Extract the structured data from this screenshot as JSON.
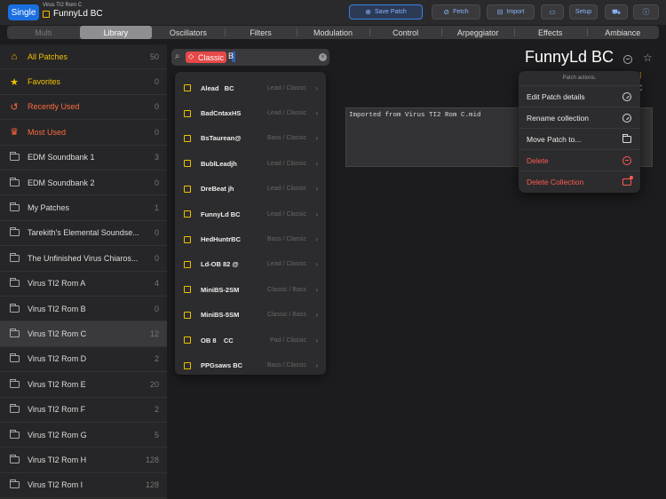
{
  "topbar": {
    "mode_label": "Single",
    "rom_name": "Virus TI2 Rom C",
    "patch_name": "FunnyLd BC",
    "buttons": {
      "save": "Save Patch",
      "fetch": "Fetch",
      "import": "Import",
      "setup": "Setup"
    }
  },
  "tabs": [
    {
      "label": "Multi",
      "state": "disabled"
    },
    {
      "label": "Library",
      "state": "active"
    },
    {
      "label": "Oscillators",
      "state": "normal"
    },
    {
      "label": "Filters",
      "state": "normal"
    },
    {
      "label": "Modulation",
      "state": "normal"
    },
    {
      "label": "Control",
      "state": "normal"
    },
    {
      "label": "Arpeggiator",
      "state": "normal"
    },
    {
      "label": "Effects",
      "state": "normal"
    },
    {
      "label": "Ambiance",
      "state": "normal"
    }
  ],
  "sidebar": {
    "items": [
      {
        "label": "All Patches",
        "count": "50",
        "icon": "home-icon",
        "color": "#f0c000"
      },
      {
        "label": "Favorites",
        "count": "0",
        "icon": "star-icon",
        "color": "#f0c000"
      },
      {
        "label": "Recently Used",
        "count": "0",
        "icon": "history-icon",
        "color": "#ff6a3d"
      },
      {
        "label": "Most Used",
        "count": "0",
        "icon": "crown-icon",
        "color": "#ff6a3d"
      },
      {
        "label": "EDM Soundbank 1",
        "count": "3",
        "icon": "folder-icon"
      },
      {
        "label": "EDM Soundbank 2",
        "count": "0",
        "icon": "folder-icon"
      },
      {
        "label": "My Patches",
        "count": "1",
        "icon": "folder-icon"
      },
      {
        "label": "Tarekith's Elemental Soundse...",
        "count": "0",
        "icon": "folder-icon"
      },
      {
        "label": "The Unfinished Virus Chiaros...",
        "count": "0",
        "icon": "folder-icon"
      },
      {
        "label": "Virus TI2 Rom A",
        "count": "4",
        "icon": "folder-icon"
      },
      {
        "label": "Virus TI2 Rom B",
        "count": "0",
        "icon": "folder-icon"
      },
      {
        "label": "Virus TI2 Rom C",
        "count": "12",
        "icon": "folder-icon",
        "selected": true
      },
      {
        "label": "Virus TI2 Rom D",
        "count": "2",
        "icon": "folder-icon"
      },
      {
        "label": "Virus TI2 Rom E",
        "count": "20",
        "icon": "folder-icon"
      },
      {
        "label": "Virus TI2 Rom F",
        "count": "2",
        "icon": "folder-icon"
      },
      {
        "label": "Virus TI2 Rom G",
        "count": "5",
        "icon": "folder-icon"
      },
      {
        "label": "Virus TI2 Rom H",
        "count": "128",
        "icon": "folder-icon"
      },
      {
        "label": "Virus TI2 Rom I",
        "count": "128",
        "icon": "folder-icon"
      }
    ]
  },
  "search": {
    "token": "Classic",
    "query": "B"
  },
  "results": [
    {
      "name": "Alead   BC",
      "category": "Lead / Classic"
    },
    {
      "name": "BadCntaxHS",
      "category": "Lead / Classic"
    },
    {
      "name": "BsTaurean@",
      "category": "Bass / Classic"
    },
    {
      "name": "BublLeadjh",
      "category": "Lead / Classic"
    },
    {
      "name": "DreBeat jh",
      "category": "Lead / Classic"
    },
    {
      "name": "FunnyLd BC",
      "category": "Lead / Classic"
    },
    {
      "name": "HedHuntrBC",
      "category": "Bass / Classic"
    },
    {
      "name": "Ld-OB 82 @",
      "category": "Lead / Classic"
    },
    {
      "name": "MiniBS-2SM",
      "category": "Classic / Bass"
    },
    {
      "name": "MiniBS-5SM",
      "category": "Classic / Bass"
    },
    {
      "name": "OB 8    CC",
      "category": "Pad / Classic"
    },
    {
      "name": "PPGsaws BC",
      "category": "Bass / Classic"
    }
  ],
  "detail": {
    "title": "FunnyLd BC",
    "tag_fragment": "sic ]",
    "rom_fragment": "m C",
    "description": "Imported from Virus TI2 Rom C.mid"
  },
  "actions": {
    "header": "Patch actions.",
    "items": [
      {
        "label": "Edit Patch details",
        "icon": "edit-circle-icon",
        "kind": "check-circle",
        "danger": false
      },
      {
        "label": "Rename collection",
        "icon": "rename-circle-icon",
        "kind": "check-circle",
        "danger": false
      },
      {
        "label": "Move Patch to...",
        "icon": "folder-icon",
        "kind": "folder-ic",
        "danger": false
      },
      {
        "label": "Delete",
        "icon": "minus-circle-icon",
        "kind": "minus-circle",
        "danger": true
      },
      {
        "label": "Delete Collection",
        "icon": "folder-delete-icon",
        "kind": "folder-del",
        "danger": true
      }
    ]
  }
}
